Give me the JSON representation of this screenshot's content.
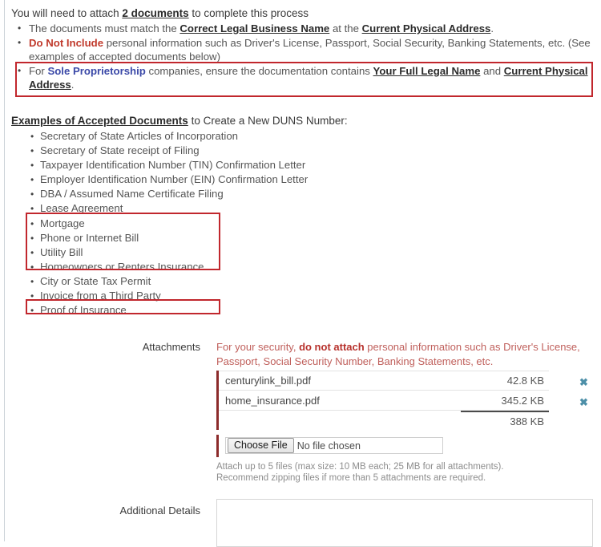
{
  "intro": {
    "lead_prefix": "You will need to attach ",
    "lead_link": "2 documents",
    "lead_suffix": " to complete this process",
    "bullets": [
      {
        "parts": [
          {
            "t": "The documents must match the ",
            "s": "plain"
          },
          {
            "t": "Correct Legal Business Name",
            "s": "underline"
          },
          {
            "t": " at the ",
            "s": "plain"
          },
          {
            "t": "Current Physical Address",
            "s": "underline"
          },
          {
            "t": ".",
            "s": "plain"
          }
        ]
      },
      {
        "parts": [
          {
            "t": "Do Not Include",
            "s": "warn"
          },
          {
            "t": " personal information such as Driver's License, Passport, Social Security, Banking Statements, etc. (See examples of accepted documents below)",
            "s": "plain"
          }
        ]
      },
      {
        "parts": [
          {
            "t": "For ",
            "s": "plain"
          },
          {
            "t": "Sole Proprietorship",
            "s": "blue"
          },
          {
            "t": " companies, ensure the documentation contains ",
            "s": "plain"
          },
          {
            "t": "Your Full Legal Name",
            "s": "underline"
          },
          {
            "t": " and ",
            "s": "plain"
          },
          {
            "t": "Current Physical Address",
            "s": "underline"
          },
          {
            "t": ".",
            "s": "plain"
          }
        ]
      }
    ]
  },
  "examples": {
    "heading_link": "Examples of Accepted Documents",
    "heading_rest": " to Create a New DUNS Number:",
    "items": [
      "Secretary of State Articles of Incorporation",
      "Secretary of State receipt of Filing",
      "Taxpayer Identification Number (TIN) Confirmation Letter",
      "Employer Identification Number (EIN) Confirmation Letter",
      "DBA / Assumed Name Certificate Filing",
      "Lease Agreement",
      "Mortgage",
      "Phone or Internet Bill",
      "Utility Bill",
      "Homeowners or Renters Insurance",
      "City or State Tax Permit",
      "Invoice from a Third Party",
      "Proof of Insurance"
    ]
  },
  "annotations": {
    "color": "#c1272d",
    "boxes": [
      "sole-proprietorship-line",
      "bills-group",
      "proof-of-insurance"
    ]
  },
  "form": {
    "attachments_label": "Attachments",
    "additional_details_label": "Additional Details",
    "warning": {
      "prefix": "For your security, ",
      "bold": "do not attach",
      "suffix": " personal information such as Driver's License, Passport, Social Security Number, Banking Statements, etc."
    },
    "files": [
      {
        "name": "centurylink_bill.pdf",
        "size": "42.8 KB",
        "remove": "✖"
      },
      {
        "name": "home_insurance.pdf",
        "size": "345.2 KB",
        "remove": "✖"
      }
    ],
    "total_size": "388 KB",
    "file_input": {
      "button_label": "Choose File",
      "status": "No file chosen"
    },
    "help_line_1": "Attach up to 5 files (max size: 10 MB each; 25 MB for all attachments).",
    "help_line_2": "Recommend zipping files if more than 5 attachments are required.",
    "details_value": "",
    "details_placeholder": ""
  },
  "colors": {
    "annotation_red": "#c1272d",
    "warning_red": "#c0392b",
    "link_blue": "#3b49a8",
    "remove_icon": "#4d8fa8",
    "table_accent": "#8c2b2b"
  }
}
